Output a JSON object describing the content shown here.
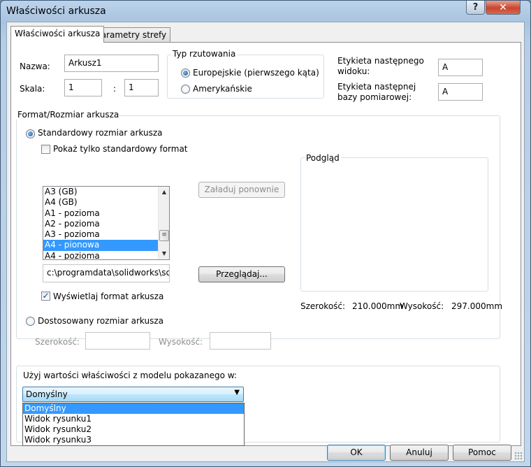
{
  "window": {
    "title": "Właściwości arkusza"
  },
  "tabs": [
    {
      "label": "Właściwości arkusza",
      "active": true
    },
    {
      "label": "Parametry strefy",
      "active": false
    }
  ],
  "name": {
    "label": "Nazwa:",
    "value": "Arkusz1"
  },
  "scale": {
    "label": "Skala:",
    "numerator": "1",
    "separator": ":",
    "denominator": "1"
  },
  "projection": {
    "legend": "Typ rzutowania",
    "options": [
      {
        "label": "Europejskie (pierwszego kąta)",
        "checked": true
      },
      {
        "label": "Amerykańskie",
        "checked": false
      }
    ]
  },
  "next_view_label": {
    "label_line1": "Etykieta następnego",
    "label_line2": "widoku:",
    "value": "A"
  },
  "next_datum_label": {
    "label_line1": "Etykieta następnej",
    "label_line2": "bazy pomiarowej:",
    "value": "A"
  },
  "format": {
    "legend": "Format/Rozmiar arkusza",
    "standard_radio": {
      "label": "Standardowy rozmiar arkusza",
      "checked": true
    },
    "show_standard_only": {
      "label": "Pokaż tylko standardowy format",
      "checked": false
    },
    "sizes": [
      "A3 (GB)",
      "A4 (GB)",
      "A1 - pozioma",
      "A2 - pozioma",
      "A3 - pozioma",
      "A4 - pionowa",
      "A4 - pozioma"
    ],
    "selected_size": "A4 - pionowa",
    "reload_button": "Załaduj ponownie",
    "path_value": "c:\\programdata\\solidworks\\solid",
    "browse_button": "Przeglądaj...",
    "display_format": {
      "label": "Wyświetlaj format arkusza",
      "checked": true
    },
    "custom_radio": {
      "label": "Dostosowany rozmiar arkusza",
      "checked": false
    },
    "custom_width_label": "Szerokość:",
    "custom_height_label": "Wysokość:"
  },
  "preview": {
    "legend": "Podgląd",
    "width_label": "Szerokość:",
    "width_value": "210.000mm",
    "height_label": "Wysokość:",
    "height_value": "297.000mm"
  },
  "model_props": {
    "label": "Użyj wartości właściwości z modelu pokazanego w:",
    "selected": "Domyślny",
    "options": [
      "Domyślny",
      "Widok rysunku1",
      "Widok rysunku2",
      "Widok rysunku3"
    ]
  },
  "buttons": {
    "ok": "OK",
    "cancel": "Anuluj",
    "help": "Pomoc"
  },
  "icons": {
    "help": "question-mark-icon",
    "close": "close-x-icon",
    "combo": "dropdown-arrow-icon"
  }
}
